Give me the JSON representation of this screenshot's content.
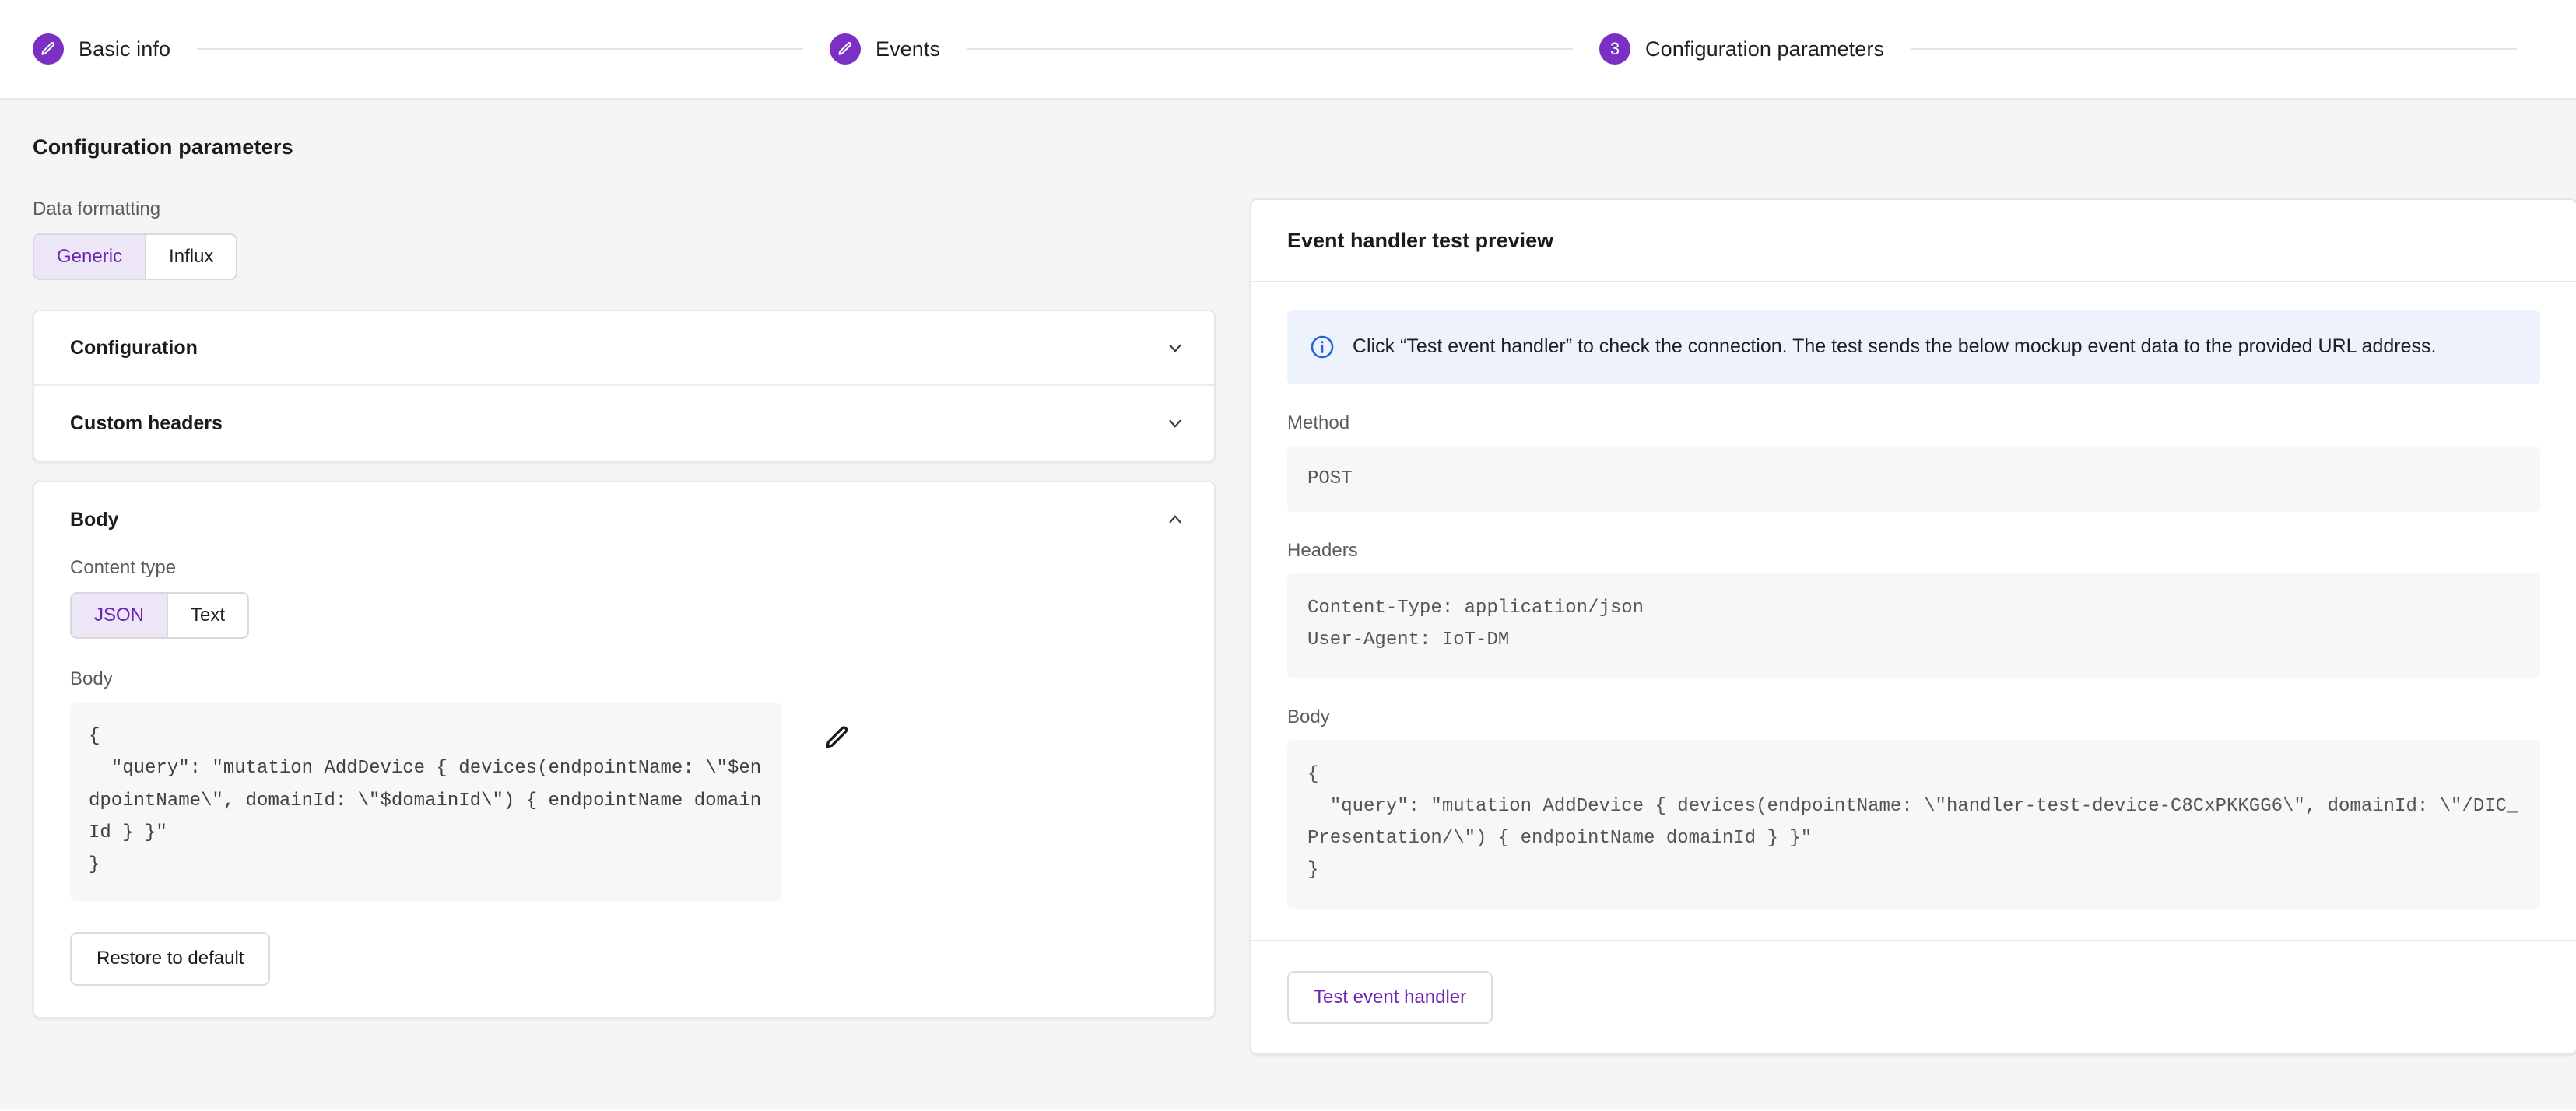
{
  "stepper": {
    "steps": [
      {
        "label": "Basic info",
        "state": "done",
        "icon": "pencil-icon",
        "number": "1"
      },
      {
        "label": "Events",
        "state": "done",
        "icon": "pencil-icon",
        "number": "2"
      },
      {
        "label": "Configuration parameters",
        "state": "active",
        "icon": "number",
        "number": "3"
      }
    ]
  },
  "page": {
    "title": "Configuration parameters"
  },
  "data_formatting": {
    "label": "Data formatting",
    "options": [
      "Generic",
      "Influx"
    ],
    "selected": "Generic"
  },
  "accordions": [
    {
      "title": "Configuration",
      "expanded": false,
      "icon": "chevron-down-icon"
    },
    {
      "title": "Custom headers",
      "expanded": false,
      "icon": "chevron-down-icon"
    }
  ],
  "body_section": {
    "title": "Body",
    "expanded": true,
    "collapse_icon": "chevron-up-icon",
    "content_type": {
      "label": "Content type",
      "options": [
        "JSON",
        "Text"
      ],
      "selected": "JSON"
    },
    "body_label": "Body",
    "body_value": "{\n  \"query\": \"mutation AddDevice { devices(endpointName: \\\"$endpointName\\\", domainId: \\\"$domainId\\\") { endpointName domainId } }\"\n}",
    "edit_icon": "pencil-icon",
    "restore_label": "Restore to default"
  },
  "preview": {
    "title": "Event handler test preview",
    "alert": {
      "icon": "info-icon",
      "text": "Click “Test event handler” to check the connection. The test sends the below mockup event data to the provided URL address."
    },
    "method": {
      "label": "Method",
      "value": "POST"
    },
    "headers": {
      "label": "Headers",
      "value": "Content-Type: application/json\nUser-Agent: IoT-DM"
    },
    "body": {
      "label": "Body",
      "value": "{\n  \"query\": \"mutation AddDevice { devices(endpointName: \\\"handler-test-device-C8CxPKKGG6\\\", domainId: \\\"/DIC_Presentation/\\\") { endpointName domainId } }\"\n}"
    },
    "test_button_label": "Test event handler"
  },
  "colors": {
    "accent": "#6d23b6",
    "badge": "#7b2fc4",
    "alert_bg": "#eef2fd",
    "alert_icon": "#2563d9",
    "page_bg": "#f5f5f6",
    "code_bg": "#f7f7f8"
  }
}
